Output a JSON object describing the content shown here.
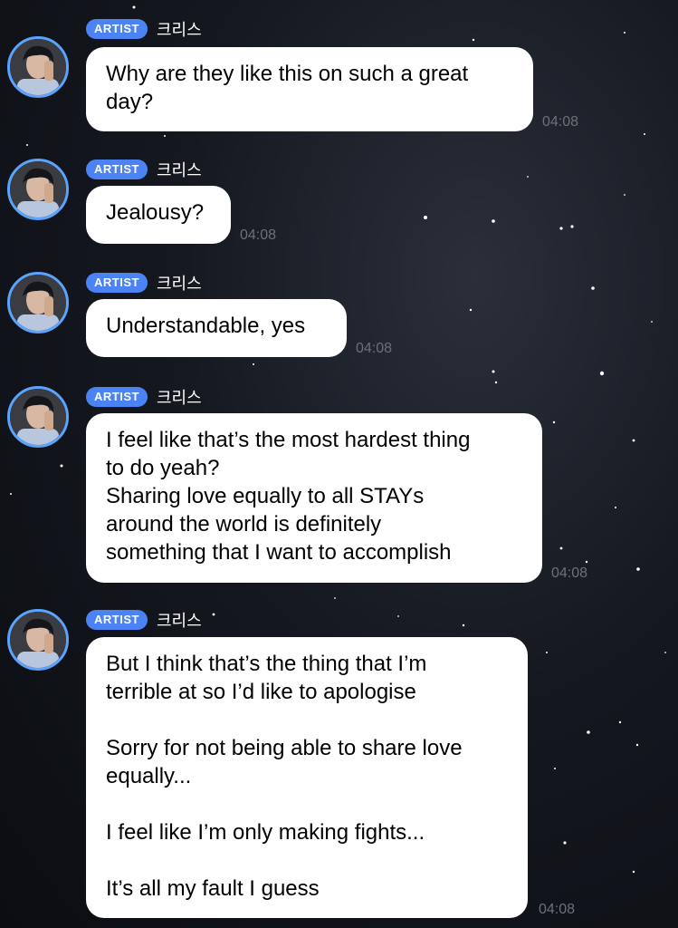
{
  "chat": {
    "messages": [
      {
        "badge": "ARTIST",
        "sender": "크리스",
        "text": "Why are they like this on such a great\nday?",
        "time": "04:08"
      },
      {
        "badge": "ARTIST",
        "sender": "크리스",
        "text": "Jealousy?",
        "time": "04:08"
      },
      {
        "badge": "ARTIST",
        "sender": "크리스",
        "text": "Understandable, yes",
        "time": "04:08"
      },
      {
        "badge": "ARTIST",
        "sender": "크리스",
        "text": "I feel like that’s the most hardest thing\nto do yeah?\nSharing love equally to all STAYs\naround the world is definitely\nsomething that I want to accomplish",
        "time": "04:08"
      },
      {
        "badge": "ARTIST",
        "sender": "크리스",
        "text": "But I think that’s the thing that I’m\nterrible at so I’d like to apologise\n\nSorry for not being able to share love\nequally...\n\nI feel like I’m only making fights...\n\nIt’s all my fault I guess",
        "time": "04:08"
      }
    ]
  },
  "colors": {
    "badge": "#4b83f5",
    "avatar_ring": "#5aa4ff",
    "bubble": "#ffffff",
    "timestamp": "#6c7079"
  }
}
